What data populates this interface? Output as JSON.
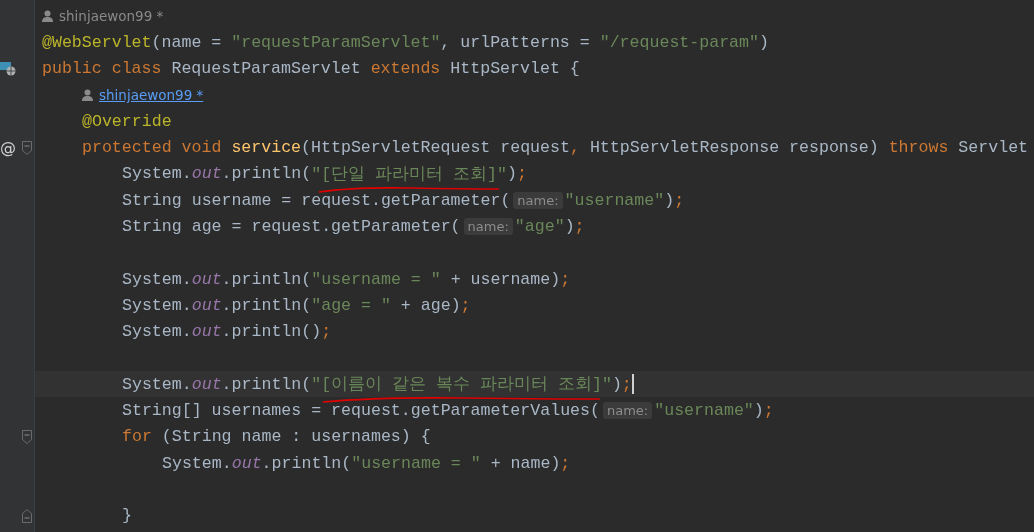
{
  "editor": {
    "lines": [
      {
        "kind": "author",
        "text": "shinjaewon99 *",
        "hovered": false
      },
      {
        "kind": "code",
        "tokens": [
          {
            "kind": "annotation",
            "text": "@WebServlet"
          },
          {
            "kind": "plain",
            "text": "(name = "
          },
          {
            "kind": "string",
            "text": "\"requestParamServlet\""
          },
          {
            "kind": "plain",
            "text": ", urlPatterns = "
          },
          {
            "kind": "string",
            "text": "\"/request-param\""
          },
          {
            "kind": "plain",
            "text": ")"
          }
        ]
      },
      {
        "kind": "code",
        "gutter": {
          "kind": "web"
        },
        "tokens": [
          {
            "kind": "keyword",
            "text": "public class "
          },
          {
            "kind": "plain",
            "text": "RequestParamServlet "
          },
          {
            "kind": "keyword",
            "text": "extends "
          },
          {
            "kind": "plain",
            "text": "HttpServlet {"
          }
        ],
        "children": [
          {
            "kind": "author",
            "text": "shinjaewon99 *",
            "hovered": true
          },
          {
            "kind": "code",
            "tokens": [
              {
                "kind": "annotation",
                "text": "@Override"
              }
            ]
          },
          {
            "kind": "code",
            "gutter": {
              "kind": "override",
              "text": "@"
            },
            "fold": {
              "kind": "start"
            },
            "tokens": [
              {
                "kind": "keyword",
                "text": "protected void "
              },
              {
                "kind": "method",
                "text": "service"
              },
              {
                "kind": "plain",
                "text": "(HttpServletRequest request"
              },
              {
                "kind": "keyword",
                "text": ","
              },
              {
                "kind": "plain",
                "text": " HttpServletResponse response) "
              },
              {
                "kind": "keyword",
                "text": "throws "
              },
              {
                "kind": "plain",
                "text": "Servlet"
              }
            ],
            "children": [
              {
                "kind": "code",
                "tokens": [
                  {
                    "kind": "plain",
                    "text": "System."
                  },
                  {
                    "kind": "field",
                    "text": "out"
                  },
                  {
                    "kind": "plain",
                    "text": ".println("
                  },
                  {
                    "kind": "string",
                    "text": "\"[단일 파라미터 조회]\"",
                    "underlined": true
                  },
                  {
                    "kind": "plain",
                    "text": ")"
                  },
                  {
                    "kind": "keyword",
                    "text": ";"
                  }
                ]
              },
              {
                "kind": "code",
                "tokens": [
                  {
                    "kind": "plain",
                    "text": "String username = request.getParameter("
                  },
                  {
                    "kind": "hint",
                    "text": "name:"
                  },
                  {
                    "kind": "string",
                    "text": "\"username\""
                  },
                  {
                    "kind": "plain",
                    "text": ")"
                  },
                  {
                    "kind": "keyword",
                    "text": ";"
                  }
                ]
              },
              {
                "kind": "code",
                "tokens": [
                  {
                    "kind": "plain",
                    "text": "String age = request.getParameter("
                  },
                  {
                    "kind": "hint",
                    "text": "name:"
                  },
                  {
                    "kind": "string",
                    "text": "\"age\""
                  },
                  {
                    "kind": "plain",
                    "text": ")"
                  },
                  {
                    "kind": "keyword",
                    "text": ";"
                  }
                ]
              },
              {
                "kind": "empty"
              },
              {
                "kind": "code",
                "tokens": [
                  {
                    "kind": "plain",
                    "text": "System."
                  },
                  {
                    "kind": "field",
                    "text": "out"
                  },
                  {
                    "kind": "plain",
                    "text": ".println("
                  },
                  {
                    "kind": "string",
                    "text": "\"username = \""
                  },
                  {
                    "kind": "plain",
                    "text": " + username)"
                  },
                  {
                    "kind": "keyword",
                    "text": ";"
                  }
                ]
              },
              {
                "kind": "code",
                "tokens": [
                  {
                    "kind": "plain",
                    "text": "System."
                  },
                  {
                    "kind": "field",
                    "text": "out"
                  },
                  {
                    "kind": "plain",
                    "text": ".println("
                  },
                  {
                    "kind": "string",
                    "text": "\"age = \""
                  },
                  {
                    "kind": "plain",
                    "text": " + age)"
                  },
                  {
                    "kind": "keyword",
                    "text": ";"
                  }
                ]
              },
              {
                "kind": "code",
                "tokens": [
                  {
                    "kind": "plain",
                    "text": "System."
                  },
                  {
                    "kind": "field",
                    "text": "out"
                  },
                  {
                    "kind": "plain",
                    "text": ".println()"
                  },
                  {
                    "kind": "keyword",
                    "text": ";"
                  }
                ]
              },
              {
                "kind": "empty"
              },
              {
                "kind": "code",
                "current": true,
                "caret": true,
                "tokens": [
                  {
                    "kind": "plain",
                    "text": "System."
                  },
                  {
                    "kind": "field",
                    "text": "out"
                  },
                  {
                    "kind": "plain",
                    "text": ".println("
                  },
                  {
                    "kind": "string",
                    "text": "\"[이름이 같은 복수 파라미터 조회]\"",
                    "underlined": true
                  },
                  {
                    "kind": "plain",
                    "text": ")"
                  },
                  {
                    "kind": "keyword",
                    "text": ";"
                  }
                ]
              },
              {
                "kind": "code",
                "tokens": [
                  {
                    "kind": "plain",
                    "text": "String[] usernames = request.getParameterValues("
                  },
                  {
                    "kind": "hint",
                    "text": "name:"
                  },
                  {
                    "kind": "string",
                    "text": "\"username\""
                  },
                  {
                    "kind": "plain",
                    "text": ")"
                  },
                  {
                    "kind": "keyword",
                    "text": ";"
                  }
                ]
              },
              {
                "kind": "code",
                "fold": {
                  "kind": "start"
                },
                "tokens": [
                  {
                    "kind": "keyword",
                    "text": "for "
                  },
                  {
                    "kind": "plain",
                    "text": "(String name : usernames) {"
                  }
                ],
                "children": [
                  {
                    "kind": "code",
                    "tokens": [
                      {
                        "kind": "plain",
                        "text": "System."
                      },
                      {
                        "kind": "field",
                        "text": "out"
                      },
                      {
                        "kind": "plain",
                        "text": ".println("
                      },
                      {
                        "kind": "string",
                        "text": "\"username = \""
                      },
                      {
                        "kind": "plain",
                        "text": " + name)"
                      },
                      {
                        "kind": "keyword",
                        "text": ";"
                      }
                    ]
                  },
                  {
                    "kind": "empty"
                  }
                ]
              },
              {
                "kind": "code",
                "fold": {
                  "kind": "end"
                },
                "tokens": [
                  {
                    "kind": "plain",
                    "text": "}"
                  }
                ]
              }
            ]
          }
        ]
      }
    ]
  }
}
